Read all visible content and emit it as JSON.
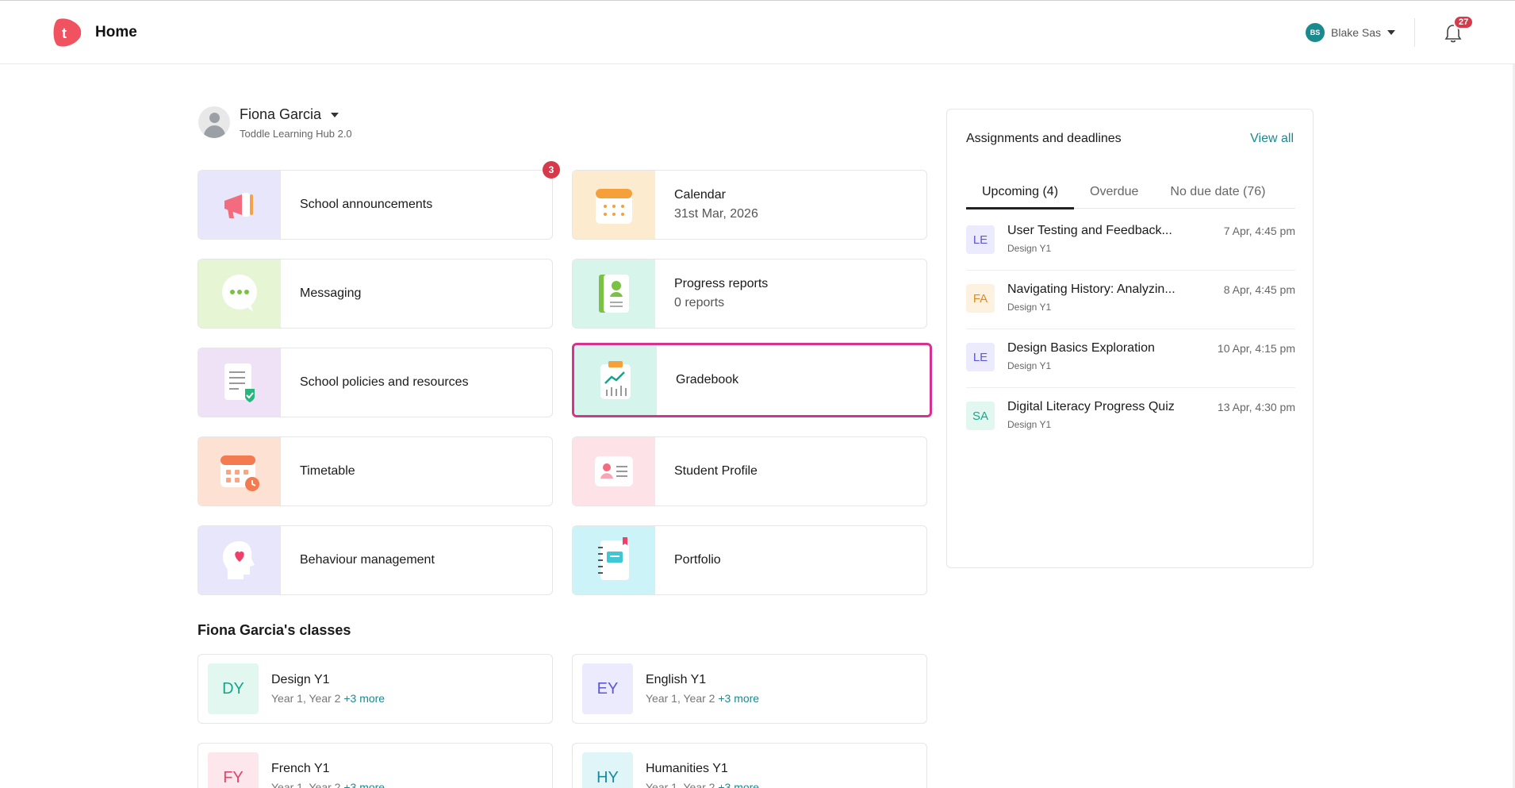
{
  "header": {
    "title": "Home",
    "logo_letter": "t",
    "user_initials": "BS",
    "user_name": "Blake Sas",
    "notification_count": "27"
  },
  "profile": {
    "name": "Fiona Garcia",
    "school": "Toddle Learning Hub 2.0"
  },
  "cards": [
    {
      "title": "School announcements",
      "badge": "3",
      "icon": "megaphone-icon"
    },
    {
      "title": "Calendar",
      "subtitle": "31st Mar, 2026",
      "icon": "calendar-icon"
    },
    {
      "title": "Messaging",
      "icon": "chat-bubble-icon"
    },
    {
      "title": "Progress reports",
      "subtitle": "0 reports",
      "icon": "report-book-icon"
    },
    {
      "title": "School policies and resources",
      "icon": "policy-document-icon"
    },
    {
      "title": "Gradebook",
      "icon": "gradebook-chart-icon",
      "selected": true
    },
    {
      "title": "Timetable",
      "icon": "timetable-icon"
    },
    {
      "title": "Student Profile",
      "icon": "profile-card-icon"
    },
    {
      "title": "Behaviour management",
      "icon": "head-heart-icon"
    },
    {
      "title": "Portfolio",
      "icon": "portfolio-notebook-icon"
    }
  ],
  "classes": {
    "title": "Fiona Garcia's classes",
    "items": [
      {
        "code": "DY",
        "name": "Design Y1",
        "grades": "Year 1, Year 2",
        "more": "+3 more"
      },
      {
        "code": "EY",
        "name": "English Y1",
        "grades": "Year 1, Year 2",
        "more": "+3 more"
      },
      {
        "code": "FY",
        "name": "French Y1",
        "grades": "Year 1, Year 2",
        "more": "+3 more"
      },
      {
        "code": "HY",
        "name": "Humanities Y1",
        "grades": "Year 1, Year 2",
        "more": "+3 more"
      }
    ]
  },
  "assignments": {
    "title": "Assignments and deadlines",
    "view_all": "View all",
    "tabs": [
      "Upcoming (4)",
      "Overdue",
      "No due date (76)"
    ],
    "items": [
      {
        "initials": "LE",
        "name": "User Testing and Feedback...",
        "class": "Design Y1",
        "date": "7 Apr, 4:45 pm"
      },
      {
        "initials": "FA",
        "name": "Navigating History: Analyzin...",
        "class": "Design Y1",
        "date": "8 Apr, 4:45 pm"
      },
      {
        "initials": "LE",
        "name": "Design Basics Exploration",
        "class": "Design Y1",
        "date": "10 Apr, 4:15 pm"
      },
      {
        "initials": "SA",
        "name": "Digital Literacy Progress Quiz",
        "class": "Design Y1",
        "date": "13 Apr, 4:30 pm"
      }
    ]
  },
  "colors": {
    "accent_teal": "#1a8a8f",
    "badge_red": "#d63a4a",
    "selection_pink": "#d6338f",
    "logo_coral": "#f0535f"
  }
}
